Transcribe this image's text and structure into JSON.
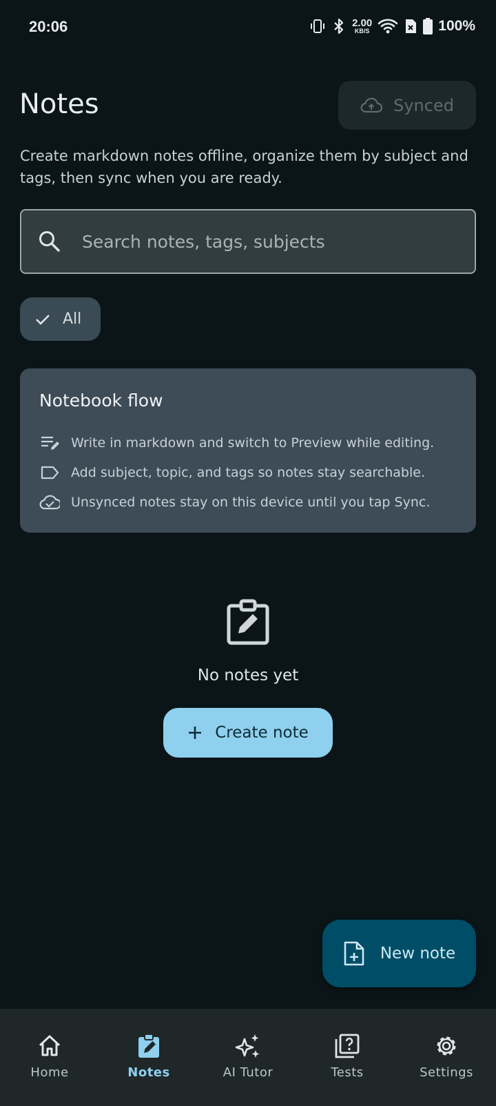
{
  "status_bar": {
    "time": "20:06",
    "net_speed_value": "2.00",
    "net_speed_unit": "KB/S",
    "battery_percent": "100%",
    "icons": [
      "vibrate-icon",
      "bluetooth-icon",
      "wifi-icon",
      "sim-off-icon",
      "battery-icon"
    ]
  },
  "header": {
    "title": "Notes",
    "sync_label": "Synced",
    "subtitle": "Create markdown notes offline, organize them by subject and tags, then sync when you are ready."
  },
  "search": {
    "placeholder": "Search notes, tags, subjects",
    "value": ""
  },
  "filters": {
    "chips": [
      {
        "label": "All",
        "selected": true
      }
    ]
  },
  "info_card": {
    "title": "Notebook flow",
    "rows": [
      {
        "icon": "edit-note-icon",
        "text": "Write in markdown and switch to Preview while editing."
      },
      {
        "icon": "label-icon",
        "text": "Add subject, topic, and tags so notes stay searchable."
      },
      {
        "icon": "cloud-done-icon",
        "text": "Unsynced notes stay on this device until you tap Sync."
      }
    ]
  },
  "empty_state": {
    "icon": "clipboard-edit-icon",
    "text": "No notes yet",
    "button_label": "Create note"
  },
  "fab": {
    "label": "New note",
    "icon": "note-add-icon"
  },
  "bottom_nav": {
    "items": [
      {
        "label": "Home",
        "icon": "home-icon",
        "active": false
      },
      {
        "label": "Notes",
        "icon": "notes-icon",
        "active": true
      },
      {
        "label": "AI Tutor",
        "icon": "sparkle-icon",
        "active": false
      },
      {
        "label": "Tests",
        "icon": "quiz-icon",
        "active": false
      },
      {
        "label": "Settings",
        "icon": "gear-icon",
        "active": false
      }
    ]
  },
  "colors": {
    "background": "#0b1518",
    "accent": "#8ed0ed",
    "fab": "#004d67",
    "card": "#3d4c57"
  }
}
